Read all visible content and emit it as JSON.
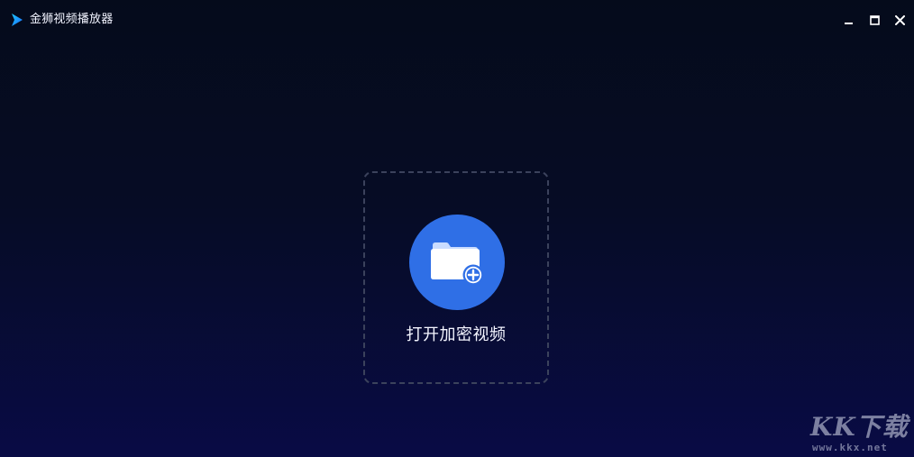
{
  "app": {
    "title": "金狮视频播放器",
    "logo_icon": "play-triangle-icon",
    "accent_color": "#1aa3ff"
  },
  "window_controls": {
    "minimize_icon": "minimize-icon",
    "maximize_icon": "maximize-icon",
    "close_icon": "close-icon"
  },
  "main": {
    "open_button": {
      "label": "打开加密视频",
      "icon": "folder-add-icon",
      "circle_color": "#2f6fe6"
    }
  },
  "watermark": {
    "logo_text": "KK下载",
    "url": "www.kkx.net"
  }
}
